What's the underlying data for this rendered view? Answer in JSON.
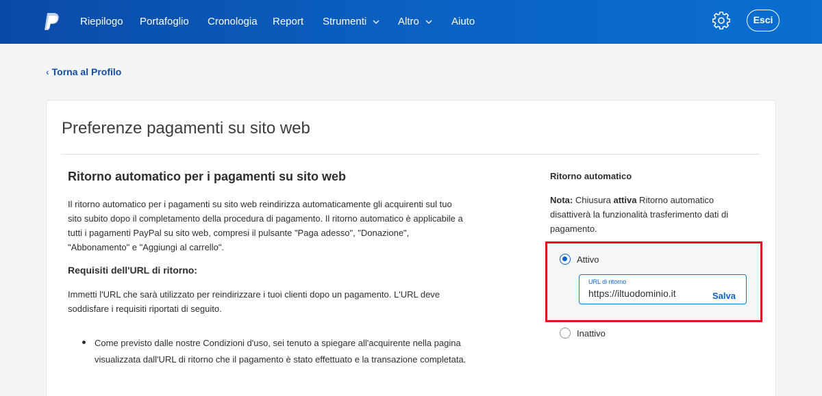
{
  "header": {
    "logo_icon": "paypal-logo-icon",
    "nav": [
      {
        "label": "Riepilogo"
      },
      {
        "label": "Portafoglio"
      },
      {
        "label": "Cronologia"
      },
      {
        "label": "Report"
      },
      {
        "label": "Strumenti"
      },
      {
        "label": "Altro"
      },
      {
        "label": "Aiuto"
      }
    ],
    "settings_icon": "gear-icon",
    "logout_label": "Esci",
    "background_color": "#0a5cba"
  },
  "back_link": {
    "label": "Torna al Profilo"
  },
  "page_title": "Preferenze pagamenti su sito web",
  "main": {
    "section_title": "Ritorno automatico per i pagamenti su sito web",
    "intro": "Il ritorno automatico per i pagamenti su sito web reindirizza automaticamente gli acquirenti sul tuo sito subito dopo il completamento della procedura di pagamento. Il ritorno automatico è applicabile a tutti i pagamenti PayPal su sito web, compresi il pulsante \"Paga adesso\", \"Donazione\", \"Abbonamento\" e \"Aggiungi al carrello\".",
    "requirements_title": "Requisiti dell'URL di ritorno:",
    "requirements_text": "Immetti l'URL che sarà utilizzato per reindirizzare i tuoi clienti dopo un pagamento. L'URL deve soddisfare i requisiti riportati di seguito.",
    "bullets": [
      "Come previsto dalle nostre Condizioni d'uso, sei tenuto a spiegare all'acquirente nella pagina visualizzata dall'URL di ritorno che il pagamento è stato effettuato e la transazione completata."
    ]
  },
  "sidebar": {
    "title": "Ritorno automatico",
    "note_prefix": "Nota:",
    "note_part1": " Chiusura ",
    "note_bold": "attiva",
    "note_part2": " Ritorno automatico disattiverà la funzionalità trasferimento dati di pagamento.",
    "options": [
      {
        "label": "Attivo",
        "selected": true
      },
      {
        "label": "Inattivo",
        "selected": false
      }
    ],
    "url_field": {
      "label": "URL di ritorno",
      "value": "https://iltuodominio.it"
    },
    "save_label": "Salva",
    "highlight_color": "#e0141e"
  }
}
